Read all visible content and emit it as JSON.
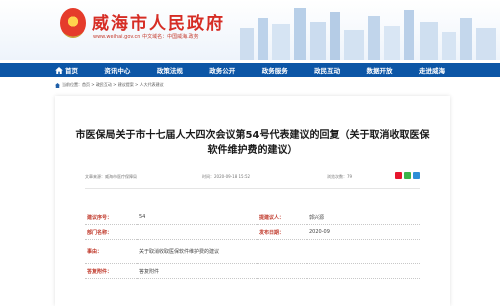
{
  "header": {
    "site_name": "威海市人民政府",
    "site_url": "www.weihai.gov.cn  中文域名：中国威海.政务",
    "colors": {
      "brand_red": "#d62d25",
      "nav_blue": "#0c56a6"
    }
  },
  "nav": {
    "items": [
      {
        "label": "首页",
        "icon": "home-icon"
      },
      {
        "label": "资讯中心"
      },
      {
        "label": "政策法规"
      },
      {
        "label": "政务公开"
      },
      {
        "label": "政务服务"
      },
      {
        "label": "政民互动"
      },
      {
        "label": "数据开放"
      },
      {
        "label": "走进威海"
      }
    ]
  },
  "breadcrumb": {
    "text": "当前位置：首页 > 政民互动 > 建议提案 > 人大代表建议"
  },
  "article": {
    "title": "市医保局关于市十七届人大四次会议第54号代表建议的回复（关于取消收取医保软件维护费的建议）",
    "source": "文章来源：威海市医疗保障局",
    "time": "时间：2020-09-18 15:52",
    "views": "浏览次数：79",
    "share_icons": [
      "weibo-icon",
      "wechat-icon",
      "share-more-icon"
    ]
  },
  "info": {
    "proposal_no_label": "建议序号：",
    "proposal_no": "54",
    "proposer_label": "提建议人：",
    "proposer": "郭兴源",
    "dept_label": "部门名称：",
    "dept": "",
    "date_label": "发布日期：",
    "date": "2020-09",
    "subject_label": "事由：",
    "subject": "关于取消收取医保软件维护费的建议",
    "attachment_label": "答复附件：",
    "attachment": "答复附件"
  }
}
